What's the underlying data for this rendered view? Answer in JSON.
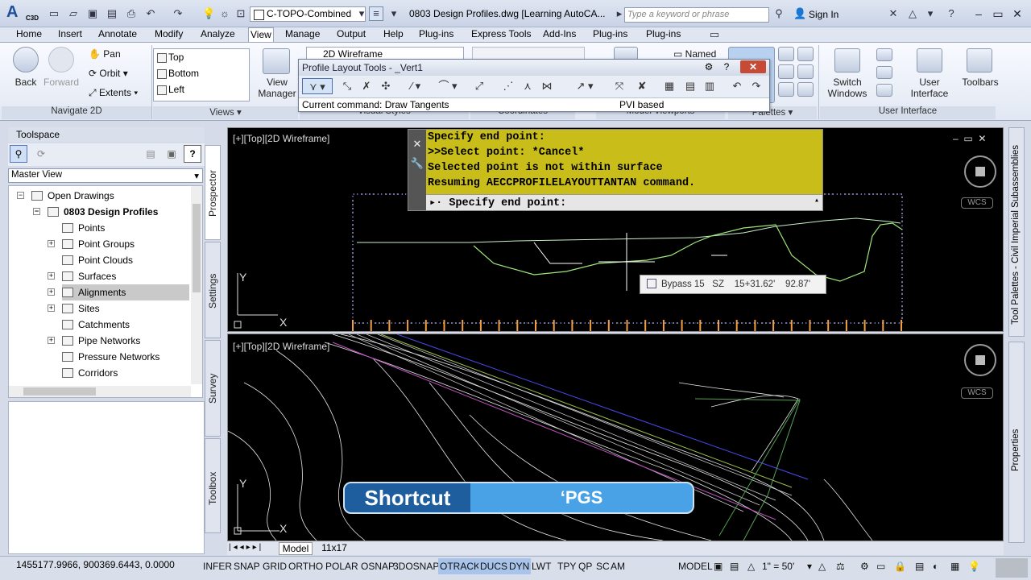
{
  "app": {
    "logo": "C3D",
    "layer": "C-TOPO-Combined",
    "document_title": "0803 Design Profiles.dwg [Learning AutoCA...",
    "search_placeholder": "Type a keyword or phrase",
    "sign_in": "Sign In"
  },
  "menu_tabs": [
    "Home",
    "Insert",
    "Annotate",
    "Modify",
    "Analyze",
    "View",
    "Manage",
    "Output",
    "Help",
    "Plug-ins",
    "Express Tools",
    "Add-Ins",
    "Plug-ins",
    "Plug-ins"
  ],
  "active_tab": "View",
  "ribbon": {
    "navigate": {
      "back": "Back",
      "forward": "Forward",
      "pan": "Pan",
      "orbit": "Orbit",
      "extents": "Extents",
      "title": "Navigate 2D"
    },
    "views": {
      "items": [
        "Top",
        "Bottom",
        "Left"
      ],
      "manager": "View Manager",
      "title": "Views"
    },
    "visual_style": "2D Wireframe",
    "visual_styles_title": "Visual Styles",
    "coordinates_title": "Coordinates",
    "named": "Named",
    "model_viewports_title": "Model Viewports",
    "palettes_title": "Palettes",
    "switch_windows": "Switch Windows",
    "user_interface": "User Interface",
    "toolbars": "Toolbars",
    "user_interface_title": "User Interface"
  },
  "profile_tools": {
    "title": "Profile Layout Tools - _Vert1",
    "current_command": "Current command: Draw Tangents",
    "mode": "PVI based"
  },
  "toolspace": {
    "title": "Toolspace",
    "view": "Master View",
    "tree": [
      "Open Drawings",
      "0803 Design Profiles",
      "Points",
      "Point Groups",
      "Point Clouds",
      "Surfaces",
      "Alignments",
      "Sites",
      "Catchments",
      "Pipe Networks",
      "Pressure Networks",
      "Corridors"
    ],
    "selected": "Alignments",
    "tabs": [
      "Prospector",
      "Settings",
      "Survey",
      "Toolbox"
    ]
  },
  "viewports": {
    "top_label": "[+][Top][2D Wireframe]",
    "bottom_label": "[+][Top][2D Wireframe]",
    "wcs": "WCS"
  },
  "command": {
    "lines": [
      "Specify end point:",
      ">>Select point: *Cancel*",
      "Selected point is not within surface",
      "Resuming AECCPROFILELAYOUTTANTAN command."
    ],
    "prompt": "Specify end point:"
  },
  "tooltip": {
    "name": "Bypass 15",
    "sz": "SZ",
    "station": "15+31.62'",
    "elev": "92.87'"
  },
  "shortcut": {
    "label": "Shortcut",
    "key": "‘PGS"
  },
  "layout_tabs": [
    "Model",
    "11x17"
  ],
  "status": {
    "coords": "1455177.9966, 900369.6443, 0.0000",
    "buttons": [
      "INFER",
      "SNAP",
      "GRID",
      "ORTHO",
      "POLAR",
      "3DOSNAP",
      "OSNAP",
      "3DOSNAP",
      "OTRACK",
      "DUCS",
      "DYN",
      "LWT",
      "TPY",
      "QP",
      "SC",
      "AM"
    ],
    "model": "MODEL",
    "scale": "1\" = 50'"
  },
  "right_palettes": [
    "Tool Palettes - Civil Imperial Subassemblies",
    "Properties"
  ],
  "colors": {
    "cmd_bg": "#c9bd1a",
    "shortcut_left": "#1f5e9e",
    "shortcut_right": "#4aa2e6",
    "viewport": "#000000"
  }
}
